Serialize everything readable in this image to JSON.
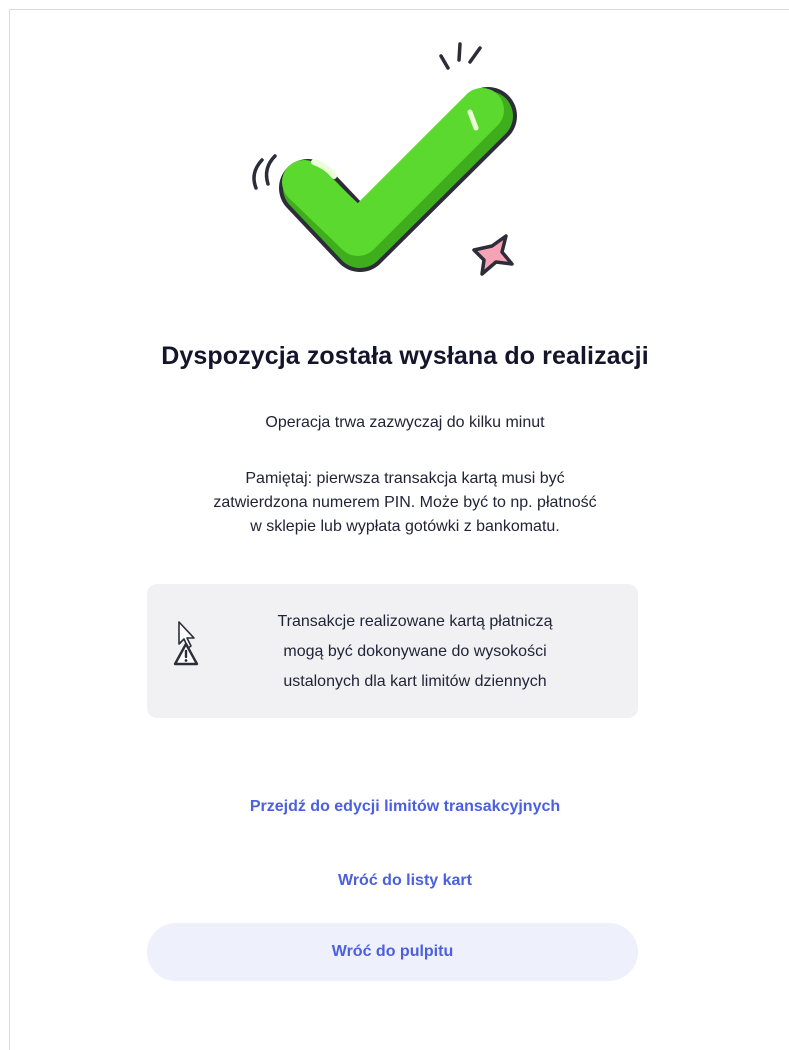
{
  "confirmation": {
    "title": "Dyspozycja została wysłana do realizacji",
    "subtitle": "Operacja trwa zazwyczaj do kilku minut",
    "note_lines": [
      "Pamiętaj: pierwsza transakcja kartą musi być",
      "zatwierdzona numerem PIN. Może być to np. płatność",
      "w sklepie lub wypłata gotówki z bankomatu."
    ]
  },
  "warning": {
    "icon": "warning-triangle-icon",
    "lines": [
      "Transakcje realizowane kartą płatniczą",
      "mogą być dokonywane do wysokości",
      "ustalonych dla kart limitów dziennych"
    ]
  },
  "actions": {
    "edit_limits_label": "Przejdź do edycji limitów transakcyjnych",
    "back_to_cards_label": "Wróć do listy kart",
    "back_to_dashboard_label": "Wróć do pulpitu"
  },
  "colors": {
    "accent": "#4b5fe0",
    "check_green": "#5bd92e",
    "star_pink": "#f5a3b5",
    "outline": "#2d2d3a",
    "warning_box_bg": "#f1f1f4",
    "button_bg": "#eef0fc"
  }
}
